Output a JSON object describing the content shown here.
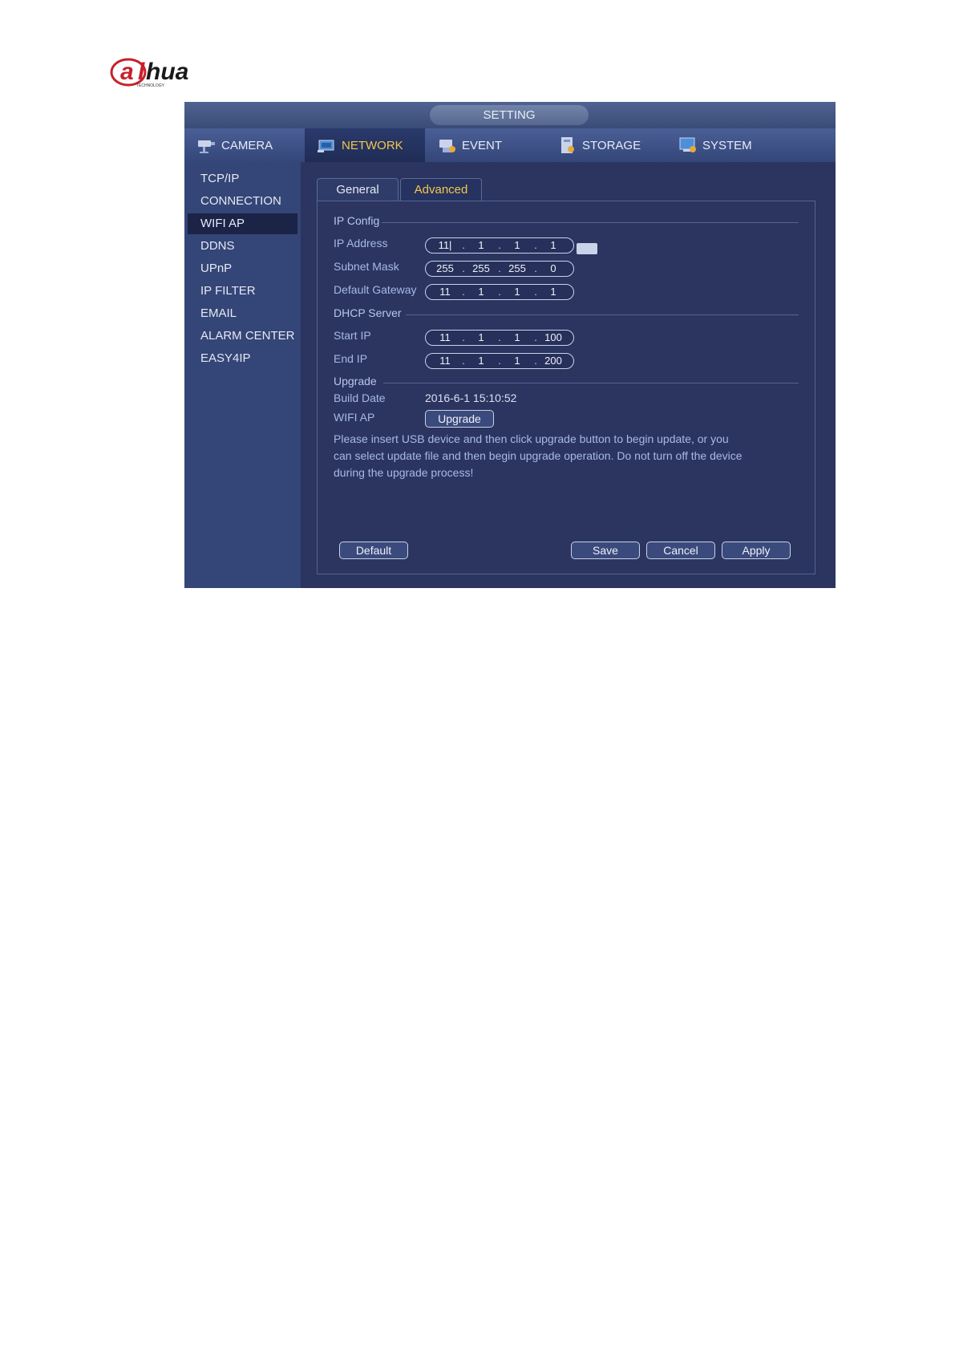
{
  "brand": {
    "logo_text": "alhua",
    "logo_subtext": "TECHNOLOGY"
  },
  "window": {
    "title": "SETTING"
  },
  "nav": {
    "tabs": [
      {
        "label": "CAMERA",
        "icon": "camera-icon"
      },
      {
        "label": "NETWORK",
        "icon": "network-icon"
      },
      {
        "label": "EVENT",
        "icon": "event-icon"
      },
      {
        "label": "STORAGE",
        "icon": "storage-icon"
      },
      {
        "label": "SYSTEM",
        "icon": "system-icon"
      }
    ],
    "active": "NETWORK"
  },
  "sidebar": {
    "items": [
      "TCP/IP",
      "CONNECTION",
      "WIFI AP",
      "DDNS",
      "UPnP",
      "IP FILTER",
      "EMAIL",
      "ALARM CENTER",
      "EASY4IP"
    ],
    "active": "WIFI AP"
  },
  "subtabs": {
    "general": "General",
    "advanced": "Advanced",
    "active": "Advanced"
  },
  "ip_config": {
    "heading": "IP Config",
    "ip_address": {
      "label": "IP Address",
      "octets": [
        "11|",
        "1",
        "1",
        "1"
      ]
    },
    "subnet_mask": {
      "label": "Subnet Mask",
      "octets": [
        "255",
        "255",
        "255",
        "0"
      ]
    },
    "default_gateway": {
      "label": "Default Gateway",
      "octets": [
        "11",
        "1",
        "1",
        "1"
      ]
    }
  },
  "dhcp": {
    "heading": "DHCP Server",
    "start_ip": {
      "label": "Start IP",
      "octets": [
        "11",
        "1",
        "1",
        "100"
      ]
    },
    "end_ip": {
      "label": "End IP",
      "octets": [
        "11",
        "1",
        "1",
        "200"
      ]
    }
  },
  "upgrade": {
    "heading": "Upgrade",
    "build_date_label": "Build Date",
    "build_date": "2016-6-1 15:10:52",
    "wifi_ap_label": "WIFI AP",
    "upgrade_button": "Upgrade",
    "notice": "Please insert USB device and then click upgrade button to begin update, or you can select update file and then begin upgrade operation. Do not turn off the device during the upgrade process!"
  },
  "buttons": {
    "default": "Default",
    "save": "Save",
    "cancel": "Cancel",
    "apply": "Apply"
  },
  "colors": {
    "active_tab_text": "#f2c84b",
    "panel_bg": "#2b3560",
    "label_text": "#a9b8e6"
  }
}
